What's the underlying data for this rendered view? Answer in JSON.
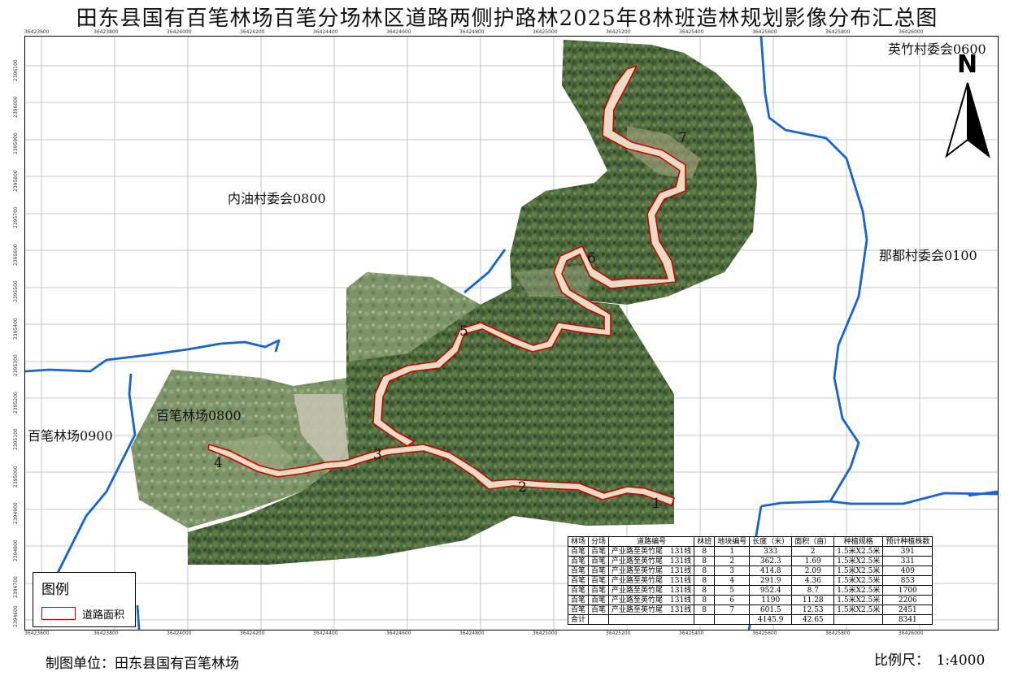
{
  "title": "田东县国有百笔林场百笔分场林区道路两侧护路林2025年8林班造林规划影像分布汇总图",
  "grid": {
    "x_labels": [
      "36423600",
      "36423800",
      "36424000",
      "36424200",
      "36424400",
      "36424600",
      "36424800",
      "36425000",
      "36425200",
      "36425400",
      "36425600",
      "36425800",
      "36426000"
    ],
    "y_labels": [
      "2396100",
      "2396000",
      "2395900",
      "2395800",
      "2395700",
      "2395600",
      "2395500",
      "2395400",
      "2395300",
      "2395200",
      "2395100",
      "2395000",
      "2394900",
      "2394800",
      "2394700",
      "2394600"
    ]
  },
  "regions": {
    "yingzhu": "英竹村委会0600",
    "neiyou": "内油村委会0800",
    "nadu": "那都村委会0100",
    "baibi_farm_0800": "百笔林场0800",
    "baibi_farm_0900": "百笔林场0900"
  },
  "segments": [
    "1",
    "2",
    "3",
    "4",
    "5",
    "6",
    "7"
  ],
  "north_label": "N",
  "legend": {
    "title": "图例",
    "item": "道路面积",
    "swatch_color": "#d00000"
  },
  "colors": {
    "road_outline": "#d00000",
    "boundary": "#1464d8",
    "imagery_dark": "#3f5a32",
    "imagery_light": "#6d8a57"
  },
  "table": {
    "headers": [
      "林场",
      "分场",
      "道路编号",
      "林班",
      "地块编号",
      "长度（米）",
      "面积（亩）",
      "种植规格",
      "预计种植株数"
    ],
    "rows": [
      [
        "百笔",
        "百笔",
        "产业路至英竹尾　131线",
        "8",
        "1",
        "333",
        "2",
        "1.5米X2.5米",
        "391"
      ],
      [
        "百笔",
        "百笔",
        "产业路至英竹尾　131线",
        "8",
        "2",
        "362.3",
        "1.69",
        "1.5米X2.5米",
        "331"
      ],
      [
        "百笔",
        "百笔",
        "产业路至英竹尾　131线",
        "8",
        "3",
        "414.8",
        "2.09",
        "1.5米X2.5米",
        "409"
      ],
      [
        "百笔",
        "百笔",
        "产业路至英竹尾　131线",
        "8",
        "4",
        "291.9",
        "4.36",
        "1.5米X2.5米",
        "853"
      ],
      [
        "百笔",
        "百笔",
        "产业路至英竹尾　131线",
        "8",
        "5",
        "952.4",
        "8.7",
        "1.5米X2.5米",
        "1700"
      ],
      [
        "百笔",
        "百笔",
        "产业路至英竹尾　131线",
        "8",
        "6",
        "1190",
        "11.28",
        "1.5米X2.5米",
        "2206"
      ],
      [
        "百笔",
        "百笔",
        "产业路至英竹尾　131线",
        "8",
        "7",
        "601.5",
        "12.53",
        "1.5米X2.5米",
        "2451"
      ]
    ],
    "total": [
      "合计",
      "",
      "",
      "",
      "",
      "4145.9",
      "42.65",
      "",
      "8341"
    ]
  },
  "footer": {
    "unit": "制图单位：田东县国有百笔林场",
    "scale": "比例尺：　1:4000"
  }
}
